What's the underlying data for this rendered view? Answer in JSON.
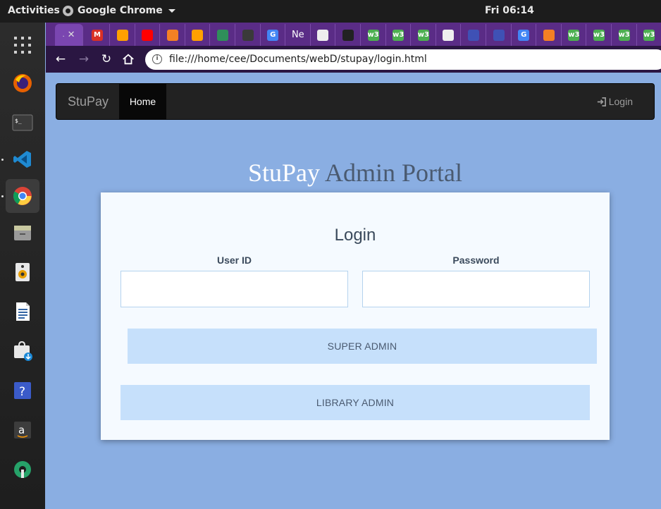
{
  "topbar": {
    "activities": "Activities",
    "app_name": "Google Chrome",
    "clock": "Fri 06:14"
  },
  "dock": {
    "items": [
      "grid-icon",
      "firefox-icon",
      "terminal-icon",
      "vscode-icon",
      "chrome-icon",
      "files-icon",
      "speaker-icon",
      "writer-icon",
      "installer-icon",
      "help-icon",
      "amazon-icon",
      "settings-icon"
    ]
  },
  "browser": {
    "active_tab_label": ".",
    "tabs": [
      {
        "icon": "gmail-icon",
        "text": "M",
        "color": "#d93025"
      },
      {
        "icon": "firebase-icon",
        "text": "",
        "color": "#ffa000"
      },
      {
        "icon": "youtube-icon",
        "text": "",
        "color": "#ff0000"
      },
      {
        "icon": "stackoverflow-icon",
        "text": "",
        "color": "#f48024"
      },
      {
        "icon": "firebase-icon",
        "text": "",
        "color": "#ffa000"
      },
      {
        "icon": "diamond-icon",
        "text": "",
        "color": "#2f8f5a"
      },
      {
        "icon": "codepen-icon",
        "text": "",
        "color": "#3a3a3a"
      },
      {
        "icon": "google-icon",
        "text": "G",
        "color": "#4285f4"
      },
      {
        "icon": "netflix-tab-label",
        "text": "Ne",
        "color": "#5a2c86"
      },
      {
        "icon": "page-icon",
        "text": "",
        "color": "#eeeeee"
      },
      {
        "icon": "bowtie-icon",
        "text": "",
        "color": "#222222"
      },
      {
        "icon": "w3schools-icon",
        "text": "w3",
        "color": "#4caf50"
      },
      {
        "icon": "w3schools-icon",
        "text": "w3",
        "color": "#4caf50"
      },
      {
        "icon": "w3schools-icon",
        "text": "w3",
        "color": "#4caf50"
      },
      {
        "icon": "page-icon",
        "text": "",
        "color": "#eeeeee"
      },
      {
        "icon": "globe-icon",
        "text": "",
        "color": "#3f51b5"
      },
      {
        "icon": "globe-icon",
        "text": "",
        "color": "#3f51b5"
      },
      {
        "icon": "google-icon",
        "text": "G",
        "color": "#4285f4"
      },
      {
        "icon": "stackoverflow-icon",
        "text": "",
        "color": "#f48024"
      },
      {
        "icon": "w3schools-icon",
        "text": "w3",
        "color": "#4caf50"
      },
      {
        "icon": "w3schools-icon",
        "text": "w3",
        "color": "#4caf50"
      },
      {
        "icon": "w3schools-icon",
        "text": "w3",
        "color": "#4caf50"
      },
      {
        "icon": "w3schools-icon",
        "text": "w3",
        "color": "#4caf50"
      },
      {
        "icon": "w3schools-icon",
        "text": "w3",
        "color": "#4caf50"
      }
    ],
    "url": "file:///home/cee/Documents/webD/stupay/login.html"
  },
  "page": {
    "brand": "StuPay",
    "nav_home": "Home",
    "nav_login": "Login",
    "title_accent": "StuPay",
    "title_rest": " Admin Portal",
    "login_heading": "Login",
    "user_id_label": "User ID",
    "password_label": "Password",
    "super_admin_button": "SUPER ADMIN",
    "library_admin_button": "LIBRARY ADMIN"
  },
  "colors": {
    "page_background": "#8aaee2",
    "navbar": "#222222",
    "card": "#f5faff",
    "button": "#c6e0fb",
    "tabstrip": "#5a2c86"
  }
}
